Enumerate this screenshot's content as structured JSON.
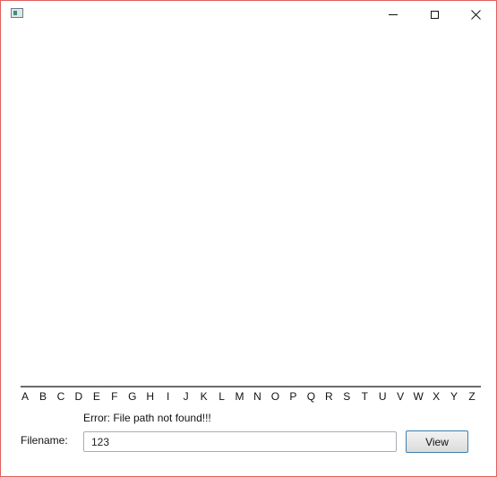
{
  "window": {
    "app_icon": "window-app-icon",
    "controls": [
      "minimize-icon",
      "maximize-icon",
      "close-icon"
    ]
  },
  "alphabet": [
    "A",
    "B",
    "C",
    "D",
    "E",
    "F",
    "G",
    "H",
    "I",
    "J",
    "K",
    "L",
    "M",
    "N",
    "O",
    "P",
    "Q",
    "R",
    "S",
    "T",
    "U",
    "V",
    "W",
    "X",
    "Y",
    "Z"
  ],
  "error": {
    "message": "Error: File path not found!!!"
  },
  "form": {
    "filename_label": "Filename:",
    "filename_value": "123",
    "view_label": "View"
  }
}
